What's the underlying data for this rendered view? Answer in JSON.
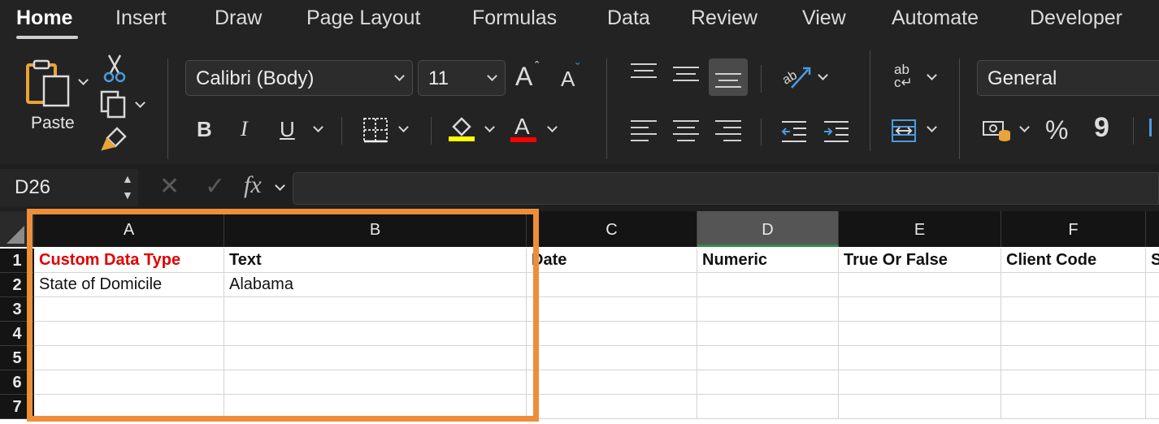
{
  "tabs": [
    "Home",
    "Insert",
    "Draw",
    "Page Layout",
    "Formulas",
    "Data",
    "Review",
    "View",
    "Automate",
    "Developer"
  ],
  "active_tab": "Home",
  "ribbon": {
    "paste_label": "Paste",
    "font_name": "Calibri (Body)",
    "font_size": "11",
    "increase_font_label": "A",
    "decrease_font_label": "A",
    "bold_label": "B",
    "italic_label": "I",
    "underline_label": "U",
    "font_color_letter": "A",
    "number_format": "General",
    "percent_label": "%",
    "comma_label": "9",
    "wrap_label": "ab",
    "highlight_color": "#ffff00",
    "font_color": "#ff0000"
  },
  "formula_bar": {
    "name_box": "D26",
    "fx_label": "fx",
    "content": ""
  },
  "sheet": {
    "columns": [
      "A",
      "B",
      "C",
      "D",
      "E",
      "F"
    ],
    "selected_column": "D",
    "rows": [
      "1",
      "2",
      "3",
      "4",
      "5",
      "6",
      "7"
    ],
    "header_row": [
      "Custom Data Type",
      "Text",
      "Date",
      "Numeric",
      "True Or False",
      "Client Code",
      "S"
    ],
    "row2": [
      "State of Domicile",
      "Alabama",
      "",
      "",
      "",
      "",
      ""
    ]
  },
  "annotation_color": "#ee8e3a"
}
